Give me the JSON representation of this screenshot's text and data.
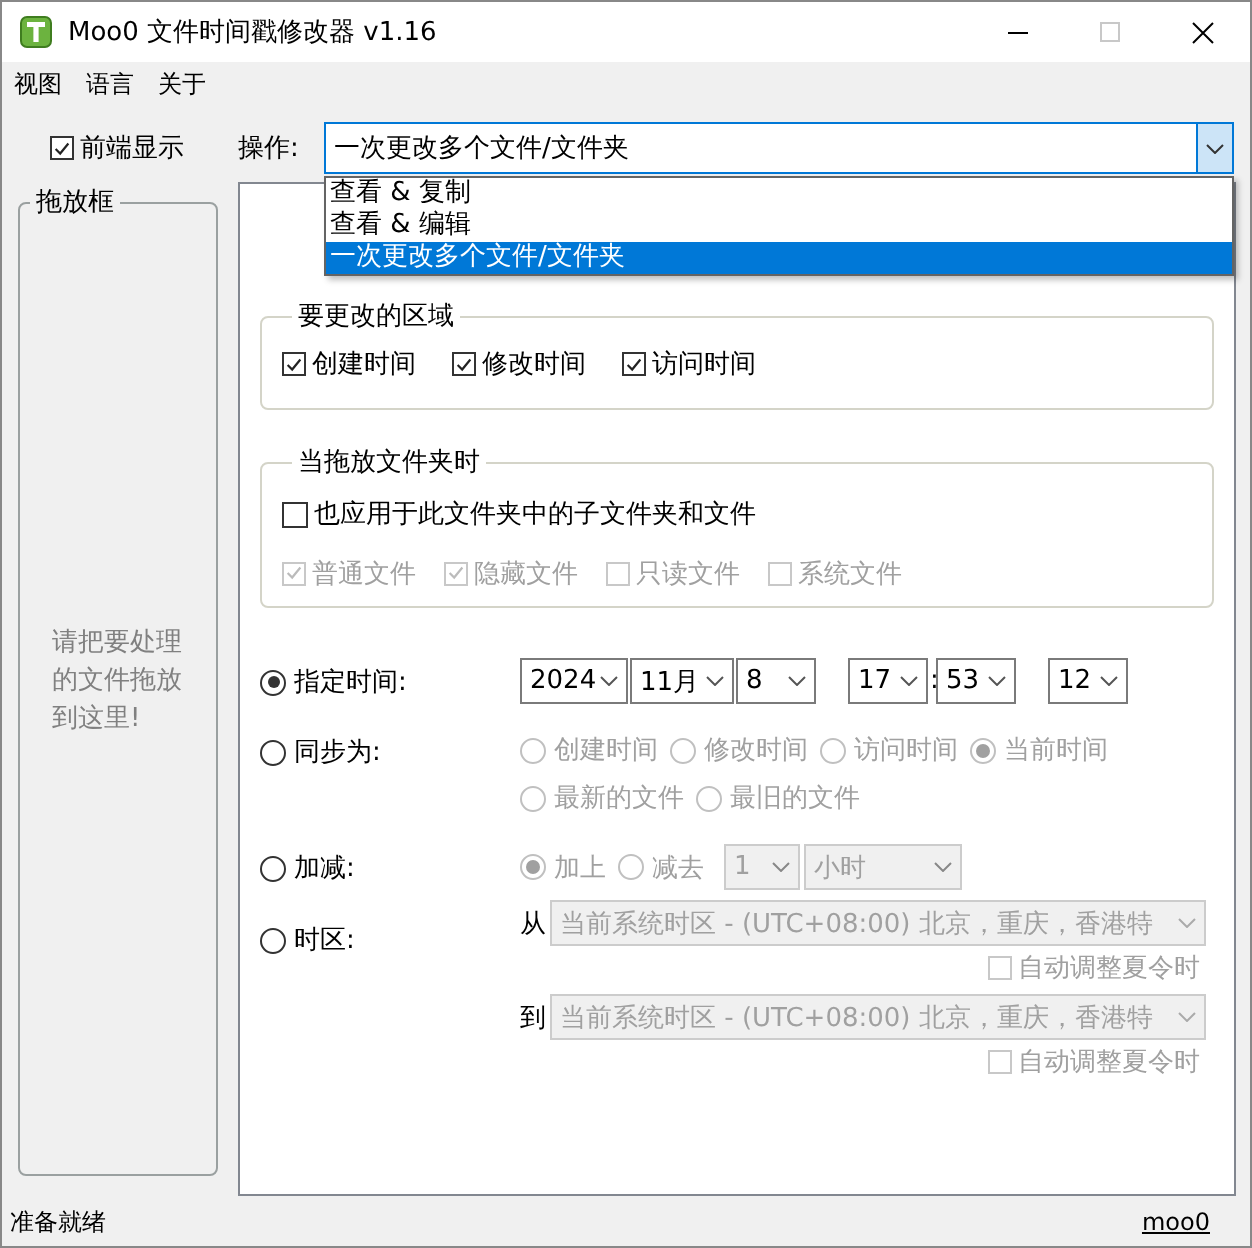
{
  "window": {
    "title": "Moo0 文件时间戳修改器 v1.16"
  },
  "menu": [
    "视图",
    "语言",
    "关于"
  ],
  "always_on_top": {
    "label": "前端显示",
    "checked": true
  },
  "operation": {
    "label": "操作:",
    "value": "一次更改多个文件/文件夹",
    "options": [
      {
        "label": "查看 & 复制",
        "selected": false
      },
      {
        "label": "查看 & 编辑",
        "selected": false
      },
      {
        "label": "一次更改多个文件/文件夹",
        "selected": true
      }
    ]
  },
  "drop_box": {
    "title": "拖放框",
    "hint": "请把要处理的文件拖放到这里!"
  },
  "fields_group": {
    "title": "要更改的区域",
    "items": [
      {
        "label": "创建时间",
        "checked": true
      },
      {
        "label": "修改时间",
        "checked": true
      },
      {
        "label": "访问时间",
        "checked": true
      }
    ]
  },
  "folder_group": {
    "title": "当拖放文件夹时",
    "subfolders": {
      "label": "也应用于此文件夹中的子文件夹和文件",
      "checked": false
    },
    "types": [
      {
        "label": "普通文件",
        "checked": true
      },
      {
        "label": "隐藏文件",
        "checked": true
      },
      {
        "label": "只读文件",
        "checked": false
      },
      {
        "label": "系统文件",
        "checked": false
      }
    ]
  },
  "modes": [
    {
      "kind": "fixed",
      "label": "指定时间:",
      "selected": true,
      "date": [
        "2024",
        "11月",
        "8"
      ],
      "time": [
        "17",
        "53"
      ],
      "separator": ":",
      "seconds": "12"
    },
    {
      "kind": "sync",
      "label": "同步为:",
      "selected": false,
      "options": [
        {
          "label": "创建时间",
          "selected": false
        },
        {
          "label": "修改时间",
          "selected": false
        },
        {
          "label": "访问时间",
          "selected": false
        },
        {
          "label": "当前时间",
          "selected": true
        },
        {
          "label": "最新的文件",
          "selected": false
        },
        {
          "label": "最旧的文件",
          "selected": false
        }
      ]
    },
    {
      "kind": "shift",
      "label": "加减:",
      "selected": false,
      "options": [
        {
          "label": "加上",
          "selected": true
        },
        {
          "label": "减去",
          "selected": false
        }
      ],
      "amount": "1",
      "unit": "小时"
    },
    {
      "kind": "timezone",
      "label": "时区:",
      "selected": false,
      "rows": [
        {
          "label": "从",
          "value": "当前系统时区 - (UTC+08:00) 北京，重庆，香港特",
          "dst": {
            "label": "自动调整夏令时",
            "checked": false
          }
        },
        {
          "label": "到",
          "value": "当前系统时区 - (UTC+08:00) 北京，重庆，香港特",
          "dst": {
            "label": "自动调整夏令时",
            "checked": false
          }
        }
      ]
    }
  ],
  "status_bar": {
    "text": "准备就绪",
    "link": "moo0"
  }
}
